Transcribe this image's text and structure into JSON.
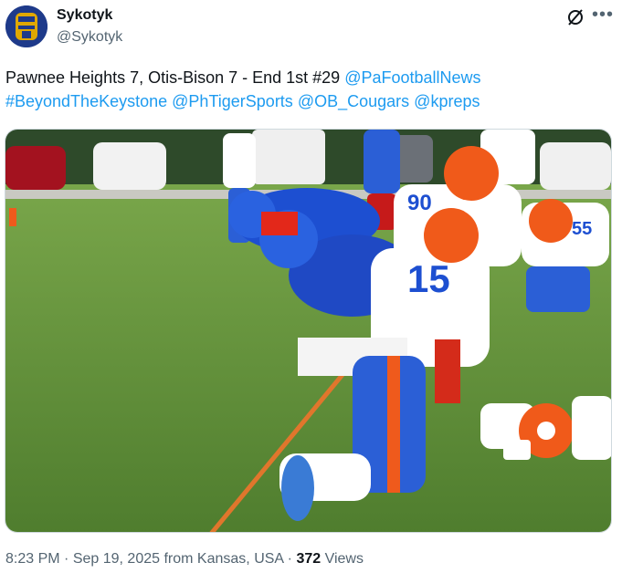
{
  "author": {
    "display_name": "Sykotyk",
    "handle": "@Sykotyk",
    "avatar_icon": "athletic-logo-avatar"
  },
  "tweet": {
    "text_plain": "Pawnee Heights 7, Otis-Bison 7 - End 1st #29",
    "mentions": [
      "@PaFootballNews",
      "#BeyondTheKeystone",
      "@PhTigerSports",
      "@OB_Cougars",
      "@kpreps"
    ],
    "link_color": "#1d9bf0"
  },
  "media": {
    "jersey_numbers": [
      "15",
      "90",
      "55"
    ]
  },
  "footer": {
    "time": "8:23 PM",
    "sep1": "·",
    "date": "Sep 19, 2025",
    "location": "from Kansas, USA",
    "sep2": "·",
    "views_count": "372",
    "views_label": "Views"
  },
  "icons": {
    "grok": "grok-icon",
    "more": "more-icon"
  },
  "colors": {
    "text_primary": "#0f1419",
    "text_secondary": "#536471",
    "link": "#1d9bf0",
    "field_green": "#5f8f3a",
    "home_blue": "#1d4fd1",
    "helmet_orange": "#f05a1a"
  }
}
